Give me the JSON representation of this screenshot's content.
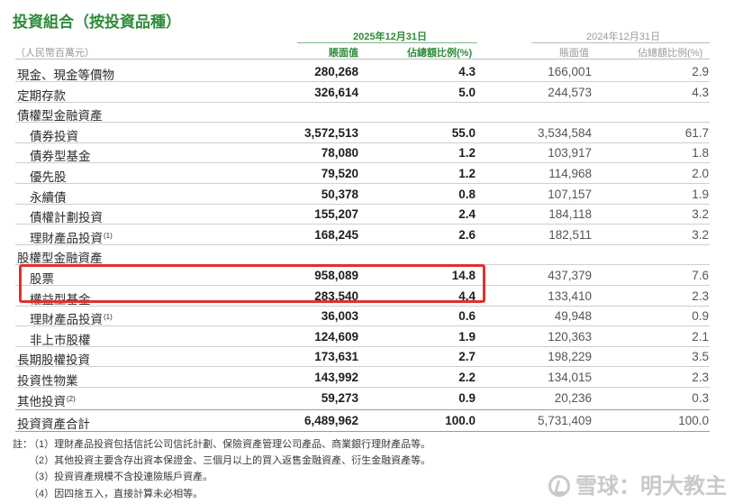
{
  "title": "投資組合（按投資品種）",
  "unit": "（人民幣百萬元）",
  "header": {
    "period_current": "2025年12月31日",
    "period_prior": "2024年12月31日",
    "col_book_value": "賬面值",
    "col_ratio": "佔總額比例(%)"
  },
  "rows": [
    {
      "label": "現金、現金等價物",
      "sup": "",
      "cur_value": "280,268",
      "cur_pct": "4.3",
      "prior_value": "166,001",
      "prior_pct": "2.9"
    },
    {
      "label": "定期存款",
      "sup": "",
      "cur_value": "326,614",
      "cur_pct": "5.0",
      "prior_value": "244,573",
      "prior_pct": "4.3"
    },
    {
      "label": "債權型金融資產",
      "sup": "",
      "cur_value": "",
      "cur_pct": "",
      "prior_value": "",
      "prior_pct": ""
    },
    {
      "label": "債券投資",
      "sup": "",
      "cur_value": "3,572,513",
      "cur_pct": "55.0",
      "prior_value": "3,534,584",
      "prior_pct": "61.7"
    },
    {
      "label": "債券型基金",
      "sup": "",
      "cur_value": "78,080",
      "cur_pct": "1.2",
      "prior_value": "103,917",
      "prior_pct": "1.8"
    },
    {
      "label": "優先股",
      "sup": "",
      "cur_value": "79,520",
      "cur_pct": "1.2",
      "prior_value": "114,968",
      "prior_pct": "2.0"
    },
    {
      "label": "永續債",
      "sup": "",
      "cur_value": "50,378",
      "cur_pct": "0.8",
      "prior_value": "107,157",
      "prior_pct": "1.9"
    },
    {
      "label": "債權計劃投資",
      "sup": "",
      "cur_value": "155,207",
      "cur_pct": "2.4",
      "prior_value": "184,118",
      "prior_pct": "3.2"
    },
    {
      "label": "理財產品投資",
      "sup": "(1)",
      "cur_value": "168,245",
      "cur_pct": "2.6",
      "prior_value": "182,511",
      "prior_pct": "3.2"
    },
    {
      "label": "股權型金融資產",
      "sup": "",
      "cur_value": "",
      "cur_pct": "",
      "prior_value": "",
      "prior_pct": ""
    },
    {
      "label": "股票",
      "sup": "",
      "cur_value": "958,089",
      "cur_pct": "14.8",
      "prior_value": "437,379",
      "prior_pct": "7.6"
    },
    {
      "label": "權益型基金",
      "sup": "",
      "cur_value": "283,540",
      "cur_pct": "4.4",
      "prior_value": "133,410",
      "prior_pct": "2.3"
    },
    {
      "label": "理財產品投資",
      "sup": "(1)",
      "cur_value": "36,003",
      "cur_pct": "0.6",
      "prior_value": "49,948",
      "prior_pct": "0.9"
    },
    {
      "label": "非上市股權",
      "sup": "",
      "cur_value": "124,609",
      "cur_pct": "1.9",
      "prior_value": "120,363",
      "prior_pct": "2.1"
    },
    {
      "label": "長期股權投資",
      "sup": "",
      "cur_value": "173,631",
      "cur_pct": "2.7",
      "prior_value": "198,229",
      "prior_pct": "3.5"
    },
    {
      "label": "投資性物業",
      "sup": "",
      "cur_value": "143,992",
      "cur_pct": "2.2",
      "prior_value": "134,015",
      "prior_pct": "2.3"
    },
    {
      "label": "其他投資",
      "sup": "(2)",
      "cur_value": "59,273",
      "cur_pct": "0.9",
      "prior_value": "20,236",
      "prior_pct": "0.3"
    }
  ],
  "total": {
    "label": "投資資產合計",
    "cur_value": "6,489,962",
    "cur_pct": "100.0",
    "prior_value": "5,731,409",
    "prior_pct": "100.0"
  },
  "notes_prefix": "註：",
  "notes": [
    "（1）理財產品投資包括信託公司信託計劃、保險資產管理公司產品、商業銀行理財產品等。",
    "（2）其他投資主要含存出資本保證金、三個月以上的買入返售金融資產、衍生金融資產等。",
    "（3）投資資產規模不含投連險賬戶資產。",
    "（4）因四捨五入，直接計算未必相等。"
  ],
  "watermark": "雪球：明大教主"
}
